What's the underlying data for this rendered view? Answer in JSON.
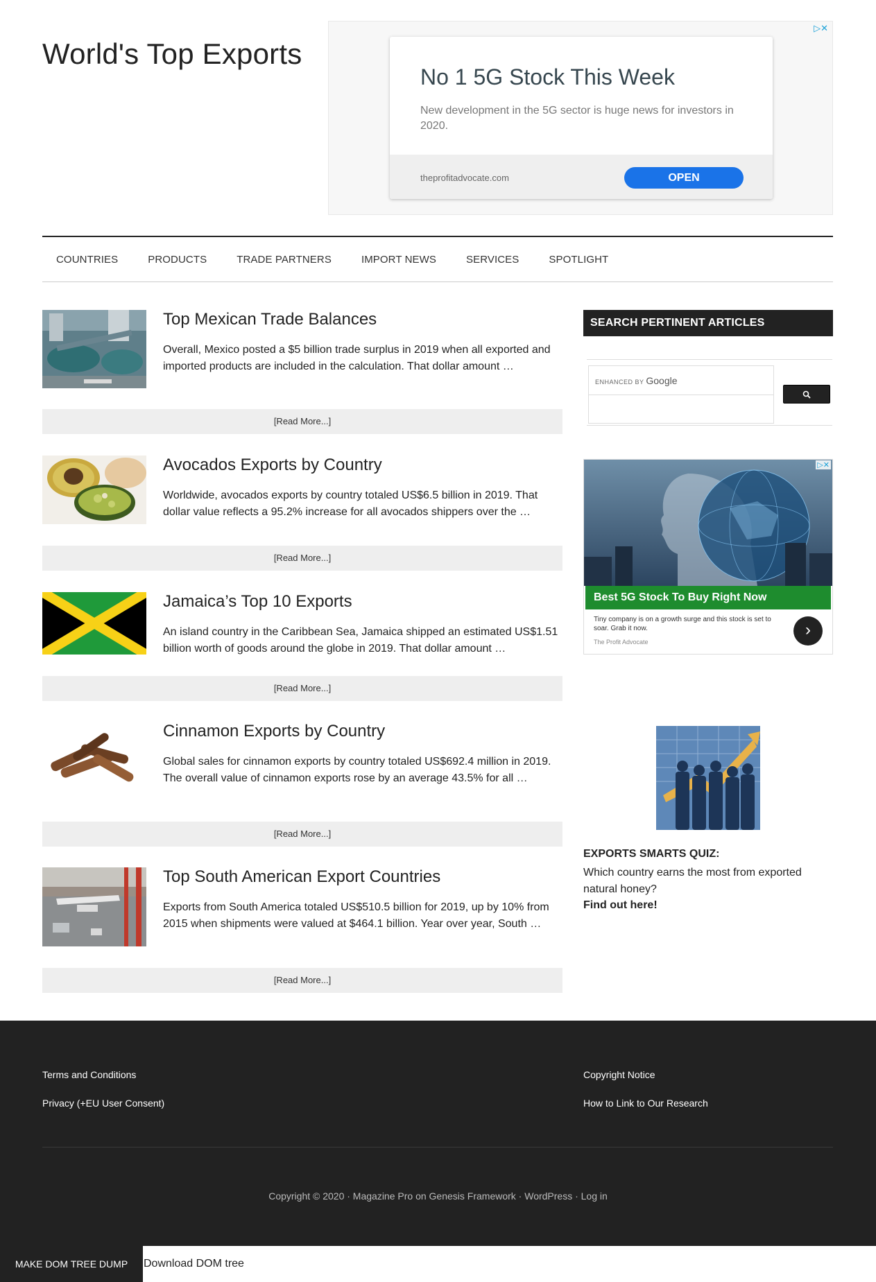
{
  "site": {
    "title": "World's Top Exports"
  },
  "top_ad": {
    "headline": "No 1 5G Stock This Week",
    "body": "New development in the 5G sector is huge news for investors in 2020.",
    "domain": "theprofitadvocate.com",
    "cta": "OPEN",
    "adchoices": "▷✕"
  },
  "nav": {
    "items": [
      "COUNTRIES",
      "PRODUCTS",
      "TRADE PARTNERS",
      "IMPORT NEWS",
      "SERVICES",
      "SPOTLIGHT"
    ]
  },
  "posts": [
    {
      "title": "Top Mexican Trade Balances",
      "excerpt": "Overall, Mexico posted a $5 billion trade surplus in 2019 when all exported and imported products are included in the calculation. That dollar amount …",
      "more": "[Read More...]"
    },
    {
      "title": "Avocados Exports by Country",
      "excerpt": "Worldwide, avocados exports by country totaled US$6.5 billion in 2019. That dollar value reflects a 95.2% increase for all avocados shippers over the …",
      "more": "[Read More...]"
    },
    {
      "title": "Jamaica’s Top 10 Exports",
      "excerpt": "An island country in the Caribbean Sea, Jamaica shipped an estimated US$1.51 billion worth of goods around the globe in 2019. That dollar amount …",
      "more": "[Read More...]"
    },
    {
      "title": "Cinnamon Exports by Country",
      "excerpt": "Global sales for cinnamon exports by country totaled US$692.4 million in 2019. The overall value of cinnamon exports rose by an average 43.5% for all …",
      "more": "[Read More...]"
    },
    {
      "title": "Top South American Export Countries",
      "excerpt": "Exports from South America totaled US$510.5 billion for 2019, up by 10% from 2015 when shipments were valued at $464.1 billion. Year over year, South …",
      "more": "[Read More...]"
    }
  ],
  "sidebar": {
    "search_title": "SEARCH PERTINENT ARTICLES",
    "search_enhanced": "ENHANCED BY",
    "search_google": "Google",
    "search_button_icon": "search-icon",
    "side_ad": {
      "headline": "Best 5G Stock To Buy Right Now",
      "body": "Tiny company is on a growth surge and this stock is set to soar. Grab it now.",
      "source": "The Profit Advocate",
      "adchoices": "▷✕"
    },
    "quiz": {
      "title": "EXPORTS SMARTS QUIZ:",
      "question": "Which country earns the most from exported natural honey?",
      "link": "Find out here!"
    }
  },
  "footer": {
    "links_left": [
      "Terms and Conditions",
      "Privacy (+EU User Consent)"
    ],
    "links_right": [
      "Copyright Notice",
      "How to Link to Our Research"
    ],
    "copyright": "Copyright © 2020 · Magazine Pro on Genesis Framework · WordPress · Log in"
  },
  "dom_bar": {
    "dump_button": "MAKE DOM TREE DUMP",
    "download_link": "Download DOM tree"
  }
}
